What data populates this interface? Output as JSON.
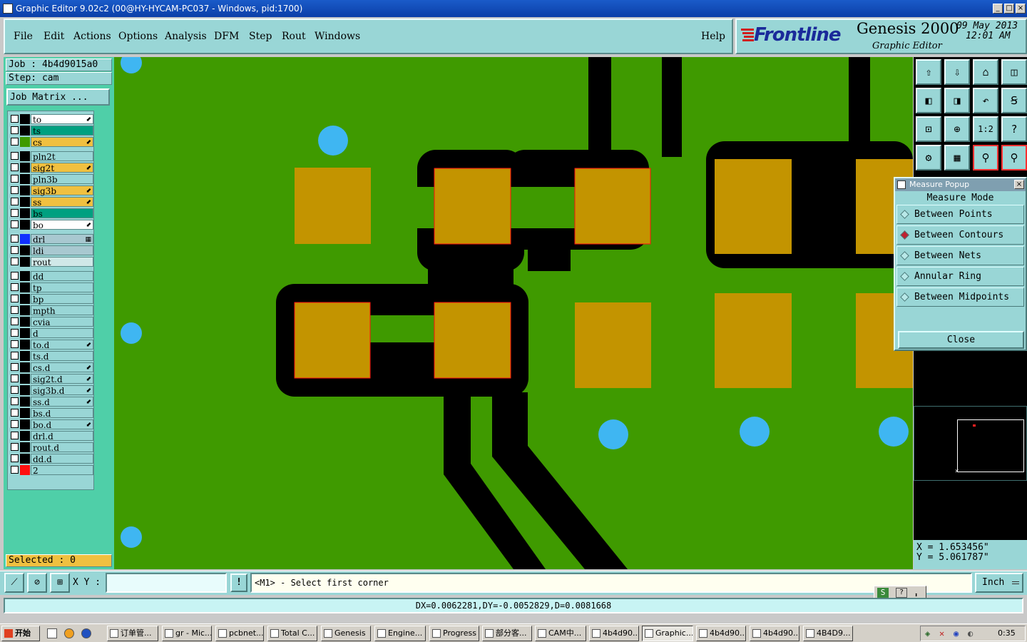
{
  "window": {
    "title": "Graphic Editor 9.02c2 (00@HY-HYCAM-PC037 - Windows, pid:1700)",
    "controls": [
      "_",
      "□",
      "×"
    ]
  },
  "menu": {
    "items": [
      "File",
      "Edit",
      "Actions",
      "Options",
      "Analysis",
      "DFM",
      "Step",
      "Rout",
      "Windows"
    ],
    "help": "Help"
  },
  "branding": {
    "logo": "Frontline",
    "product": "Genesis 2000",
    "subtitle": "Graphic Editor",
    "date": "09 May 2013",
    "time": "12:01 AM"
  },
  "job": {
    "job_label": "Job : 4b4d9015a0",
    "step_label": "Step: cam",
    "matrix_button": "Job Matrix ..."
  },
  "layers": [
    {
      "name": "to",
      "swatch": "#000000",
      "bg": "#ffffff",
      "mark": "⬋"
    },
    {
      "name": "ts",
      "swatch": "#000000",
      "bg": "#00a080",
      "mark": ""
    },
    {
      "name": "cs",
      "swatch": "#3f9a00",
      "bg": "#f0c040",
      "mark": "⬋"
    },
    {
      "name": "pln2t",
      "swatch": "#000000",
      "bg": "#99d6d6",
      "mark": ""
    },
    {
      "name": "sig2t",
      "swatch": "#000000",
      "bg": "#f0c040",
      "mark": "⬋"
    },
    {
      "name": "pln3b",
      "swatch": "#000000",
      "bg": "#99d6d6",
      "mark": ""
    },
    {
      "name": "sig3b",
      "swatch": "#000000",
      "bg": "#f0c040",
      "mark": "⬋"
    },
    {
      "name": "ss",
      "swatch": "#000000",
      "bg": "#f0c040",
      "mark": "⬋"
    },
    {
      "name": "bs",
      "swatch": "#000000",
      "bg": "#00a080",
      "mark": ""
    },
    {
      "name": "bo",
      "swatch": "#000000",
      "bg": "#ffffff",
      "mark": "⬋"
    },
    {
      "name": "drl",
      "swatch": "#1030ff",
      "bg": "#a8c8d0",
      "mark": "▦"
    },
    {
      "name": "ldi",
      "swatch": "#000000",
      "bg": "#a8c8d0",
      "mark": ""
    },
    {
      "name": "rout",
      "swatch": "#000000",
      "bg": "#d0e8e8",
      "mark": ""
    },
    {
      "name": "dd",
      "swatch": "#000000",
      "bg": "#99d6d6",
      "mark": ""
    },
    {
      "name": "tp",
      "swatch": "#000000",
      "bg": "#99d6d6",
      "mark": ""
    },
    {
      "name": "bp",
      "swatch": "#000000",
      "bg": "#99d6d6",
      "mark": ""
    },
    {
      "name": "mpth",
      "swatch": "#000000",
      "bg": "#99d6d6",
      "mark": ""
    },
    {
      "name": "cvia",
      "swatch": "#000000",
      "bg": "#99d6d6",
      "mark": ""
    },
    {
      "name": "d",
      "swatch": "#000000",
      "bg": "#99d6d6",
      "mark": ""
    },
    {
      "name": "to.d",
      "swatch": "#000000",
      "bg": "#99d6d6",
      "mark": "⬋"
    },
    {
      "name": "ts.d",
      "swatch": "#000000",
      "bg": "#99d6d6",
      "mark": ""
    },
    {
      "name": "cs.d",
      "swatch": "#000000",
      "bg": "#99d6d6",
      "mark": "⬋"
    },
    {
      "name": "sig2t.d",
      "swatch": "#000000",
      "bg": "#99d6d6",
      "mark": "⬋"
    },
    {
      "name": "sig3b.d",
      "swatch": "#000000",
      "bg": "#99d6d6",
      "mark": "⬋"
    },
    {
      "name": "ss.d",
      "swatch": "#000000",
      "bg": "#99d6d6",
      "mark": "⬋"
    },
    {
      "name": "bs.d",
      "swatch": "#000000",
      "bg": "#99d6d6",
      "mark": ""
    },
    {
      "name": "bo.d",
      "swatch": "#000000",
      "bg": "#99d6d6",
      "mark": "⬋"
    },
    {
      "name": "drl.d",
      "swatch": "#000000",
      "bg": "#99d6d6",
      "mark": ""
    },
    {
      "name": "rout.d",
      "swatch": "#000000",
      "bg": "#99d6d6",
      "mark": ""
    },
    {
      "name": "dd.d",
      "swatch": "#000000",
      "bg": "#99d6d6",
      "mark": ""
    },
    {
      "name": "2",
      "swatch": "#ff1010",
      "bg": "#99d6d6",
      "mark": ""
    }
  ],
  "selected": "Selected : 0",
  "toolbar_buttons": [
    "zoom-home-icon",
    "zoom-back-icon",
    "zoom-page-icon",
    "split-view-icon",
    "pan-left-icon",
    "pan-right-icon",
    "undo-view-icon",
    "redraw-icon",
    "zoom-in-icon",
    "zoom-fit-icon",
    "one-to-one-icon",
    "help-icon",
    "settings-icon",
    "grid-icon",
    "snap-icon",
    "net-icon"
  ],
  "toolbar_glyphs": [
    "⇧",
    "⇩",
    "⌂",
    "◫",
    "◧",
    "◨",
    "↶",
    "Ꞩ",
    "⊡",
    "⊕",
    "1:2",
    "?",
    "⚙",
    "▦",
    "⚲",
    "⚲"
  ],
  "measure": {
    "title": "Measure Popup",
    "header": "Measure Mode",
    "options": [
      "Between Points",
      "Between Contours",
      "Between Nets",
      "Annular Ring",
      "Between Midpoints"
    ],
    "selected_index": 1,
    "close": "Close"
  },
  "coords": {
    "x": "X = 1.653456\"",
    "y": "Y = 5.061787\""
  },
  "command": {
    "xy_label": "X Y :",
    "xy_value": "",
    "prompt": "<M1> - Select first corner",
    "unit": "Inch",
    "alert": "!"
  },
  "status": "DX=0.0062281,DY=-0.0052829,D=0.0081668",
  "taskbar": {
    "start": "开始",
    "tasks": [
      "订单管...",
      "gr - Mic...",
      "pcbnet...",
      "Total C...",
      "Genesis",
      "Engine...",
      "Progress",
      "部分客...",
      "CAM中...",
      "4b4d90...",
      "Graphic...",
      "4b4d90...",
      "4b4d90...",
      "4B4D9..."
    ],
    "active_index": 10,
    "clock": "0:35"
  }
}
